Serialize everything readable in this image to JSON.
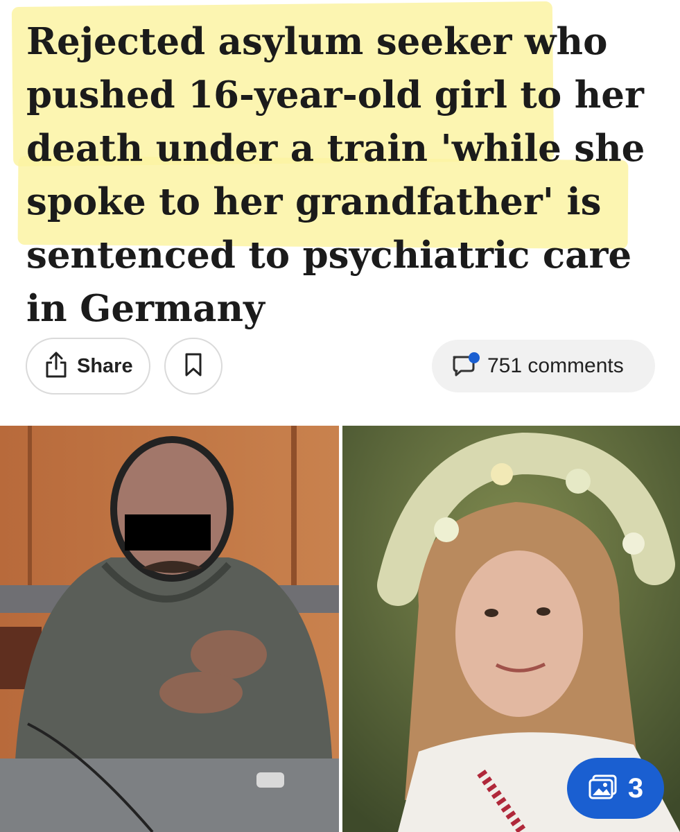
{
  "article": {
    "headline": "Rejected asylum seeker who pushed 16-year-old girl to her death under a train 'while she spoke to her grandfather' is sentenced to psychiatric care in Germany"
  },
  "actions": {
    "share_label": "Share",
    "comments_label": "751 comments",
    "comments_icon": "comment-bubble-icon",
    "bookmark_icon": "bookmark-icon",
    "share_icon": "share-icon"
  },
  "gallery": {
    "count": "3",
    "icon": "image-gallery-icon"
  },
  "colors": {
    "highlight": "#fbf3a3",
    "accent_blue": "#1a5fd1",
    "text": "#1b1b1b"
  }
}
